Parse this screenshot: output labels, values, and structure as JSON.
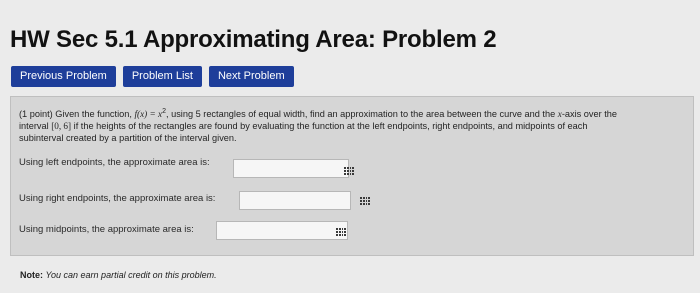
{
  "page": {
    "title": "HW Sec 5.1 Approximating Area: Problem 2"
  },
  "nav": {
    "previous_label": "Previous Problem",
    "list_label": "Problem List",
    "next_label": "Next Problem"
  },
  "problem": {
    "points": "(1 point)",
    "given_prefix": "Given the function,",
    "function_lhs": "f(x) = x",
    "function_exp": "2",
    "text_a": ", using 5 rectangles of equal width, find an approximation to the area between the curve and the",
    "x_var": "x",
    "text_b": "-axis over the",
    "text_c": "interval",
    "interval": "[0, 6]",
    "text_d": "if the heights of the rectangles are found by evaluating the function at the left endpoints, right endpoints, and midpoints of each",
    "text_e": "subinterval created by a partition of the interval given."
  },
  "answers": {
    "left": {
      "label": "Using left endpoints, the approximate area is:",
      "value": ""
    },
    "right": {
      "label": "Using right endpoints, the approximate area is:",
      "value": ""
    },
    "mid": {
      "label": "Using midpoints, the approximate area is:",
      "value": ""
    }
  },
  "note": {
    "bold": "Note:",
    "text": "You can earn partial credit on this problem."
  },
  "colors": {
    "nav_button_bg": "#1e3e9a",
    "page_bg": "#ebebeb",
    "problem_bg": "#d6d6d6"
  },
  "icons": [
    "equation-editor-grid-icon"
  ]
}
